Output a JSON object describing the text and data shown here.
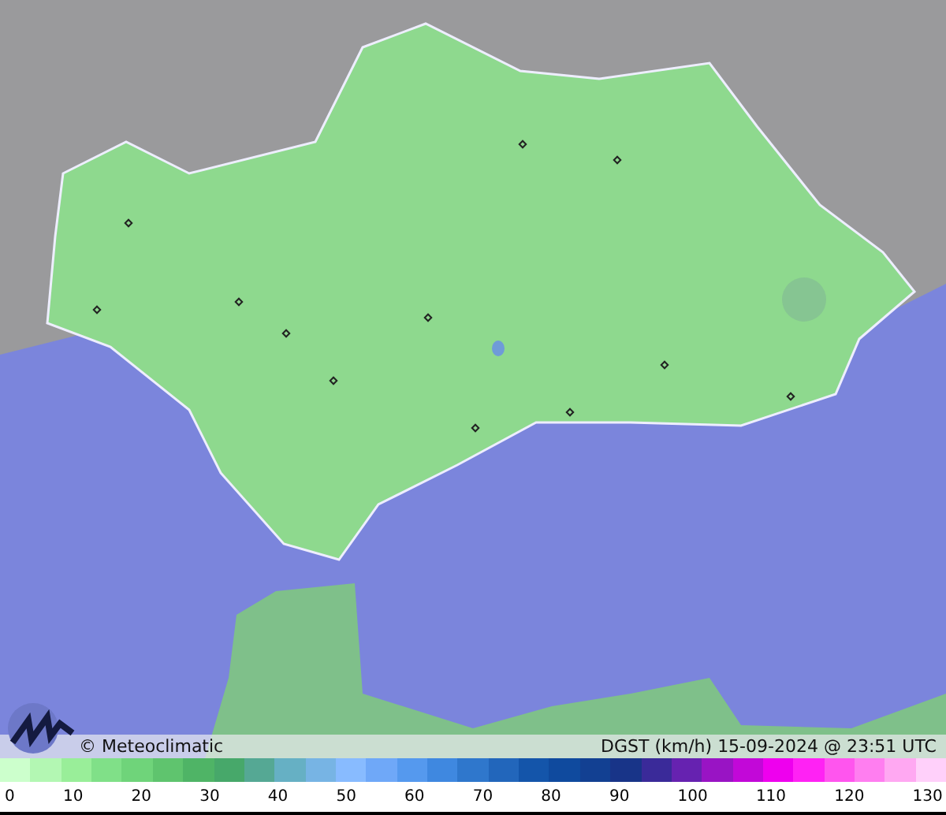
{
  "credit": "© Meteoclimatic",
  "variable": "DGST (km/h)",
  "timestamp": "15-09-2024 @ 23:51 UTC",
  "legend": {
    "segments": [
      {
        "color": "#ccffcc"
      },
      {
        "color": "#b3f7b3"
      },
      {
        "color": "#99ee99"
      },
      {
        "color": "#80e088"
      },
      {
        "color": "#6fd47a"
      },
      {
        "color": "#5fc46e"
      },
      {
        "color": "#4fb466"
      },
      {
        "color": "#47a86a"
      },
      {
        "color": "#55a894"
      },
      {
        "color": "#66b0c4"
      },
      {
        "color": "#77b4e4"
      },
      {
        "color": "#88bbff"
      },
      {
        "color": "#6fa8f8"
      },
      {
        "color": "#5599ee"
      },
      {
        "color": "#3f88e0"
      },
      {
        "color": "#2f77cc"
      },
      {
        "color": "#2266bb"
      },
      {
        "color": "#1455aa"
      },
      {
        "color": "#0f4a9e"
      },
      {
        "color": "#124092"
      },
      {
        "color": "#183488"
      },
      {
        "color": "#3a2a99"
      },
      {
        "color": "#6622b0"
      },
      {
        "color": "#9914c4"
      },
      {
        "color": "#c208d8"
      },
      {
        "color": "#ee00ee"
      },
      {
        "color": "#ff22f4"
      },
      {
        "color": "#ff55ee"
      },
      {
        "color": "#ff7ef0"
      },
      {
        "color": "#ffa8f2"
      },
      {
        "color": "#ffd0fa"
      }
    ],
    "labels": [
      "0",
      "10",
      "20",
      "30",
      "40",
      "50",
      "60",
      "70",
      "80",
      "90",
      "100",
      "110",
      "120",
      "130"
    ]
  }
}
